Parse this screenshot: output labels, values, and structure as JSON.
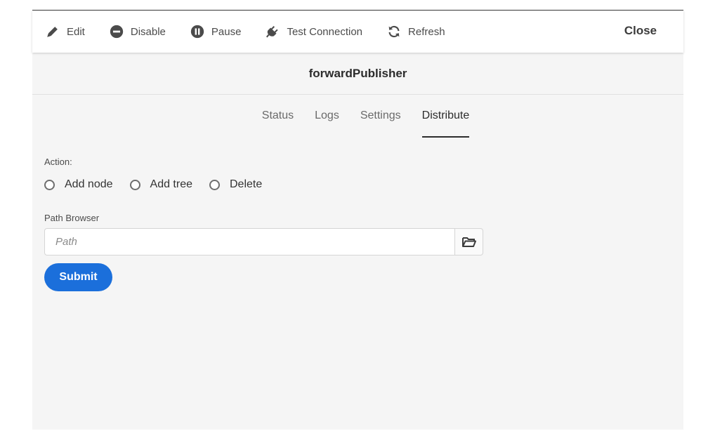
{
  "toolbar": {
    "items": [
      {
        "label": "Edit",
        "icon": "pencil-icon"
      },
      {
        "label": "Disable",
        "icon": "minus-circle-icon"
      },
      {
        "label": "Pause",
        "icon": "pause-circle-icon"
      },
      {
        "label": "Test Connection",
        "icon": "plug-icon"
      },
      {
        "label": "Refresh",
        "icon": "refresh-icon"
      }
    ],
    "close_label": "Close"
  },
  "header": {
    "title": "forwardPublisher"
  },
  "tabs": [
    {
      "label": "Status",
      "active": false
    },
    {
      "label": "Logs",
      "active": false
    },
    {
      "label": "Settings",
      "active": false
    },
    {
      "label": "Distribute",
      "active": true
    }
  ],
  "form": {
    "action_label": "Action:",
    "actions": [
      {
        "label": "Add node",
        "checked": false
      },
      {
        "label": "Add tree",
        "checked": false
      },
      {
        "label": "Delete",
        "checked": false
      }
    ],
    "path_label": "Path Browser",
    "path_placeholder": "Path",
    "path_value": "",
    "browse_icon": "folder-open-icon",
    "submit_label": "Submit"
  },
  "colors": {
    "primary": "#1b6fdb",
    "background": "#f5f5f5",
    "toolbar": "#ffffff"
  }
}
